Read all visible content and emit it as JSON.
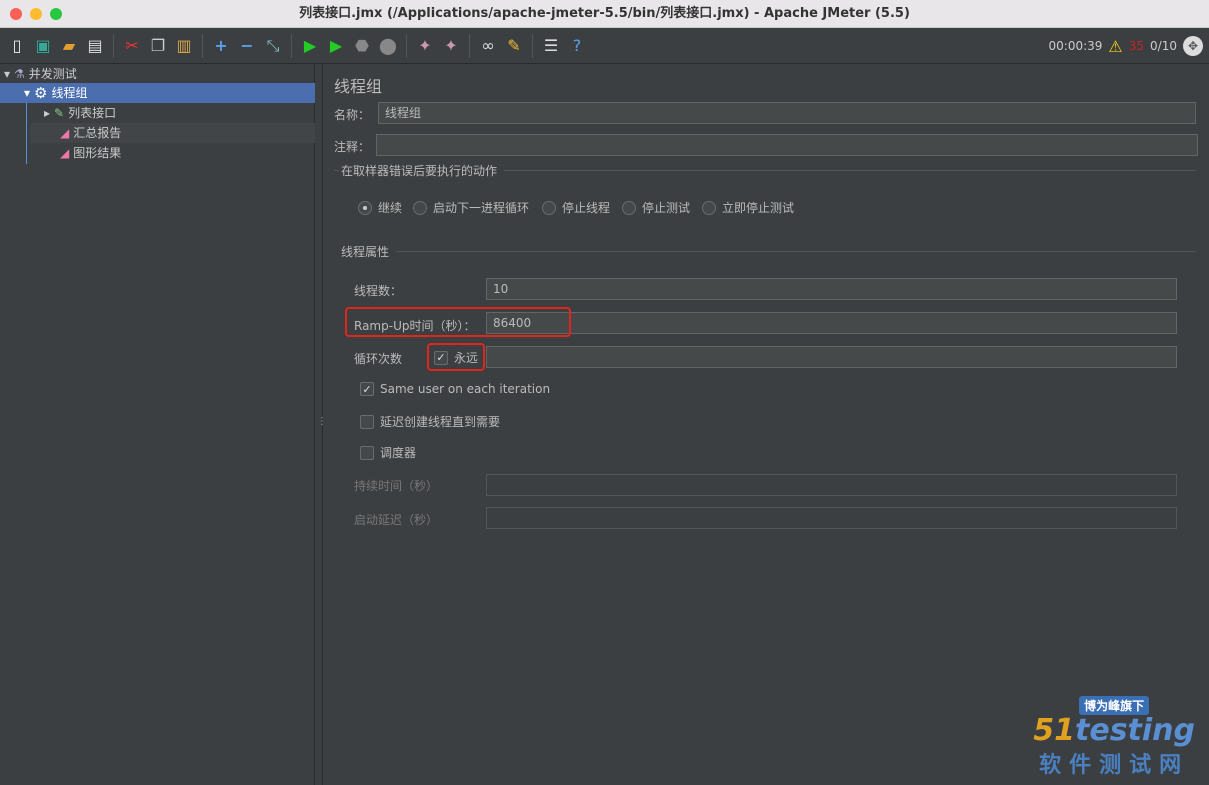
{
  "window": {
    "title": "列表接口.jmx (/Applications/apache-jmeter-5.5/bin/列表接口.jmx) - Apache JMeter (5.5)"
  },
  "toolbar": {
    "icons": [
      "new-icon",
      "templates-icon",
      "open-icon",
      "save-icon",
      "cut-icon",
      "copy-icon",
      "paste-icon",
      "expand-icon",
      "collapse-icon",
      "toggle-icon",
      "start-icon",
      "start-no-pause-icon",
      "stop-icon",
      "shutdown-icon",
      "clear-icon",
      "clear-all-icon",
      "search-icon",
      "reset-search-icon",
      "function-helper-icon",
      "help-icon"
    ],
    "elapsed": "00:00:39",
    "error_count": "35",
    "threads": "0/10"
  },
  "tree": {
    "items": [
      {
        "label": "并发测试"
      },
      {
        "label": "线程组"
      },
      {
        "label": "列表接口"
      },
      {
        "label": "汇总报告"
      },
      {
        "label": "图形结果"
      }
    ]
  },
  "panel": {
    "title": "线程组",
    "name_label": "名称：",
    "name_value": "线程组",
    "comment_label": "注释：",
    "comment_value": "",
    "error_group": "在取样器错误后要执行的动作",
    "error_options": [
      {
        "label": "继续",
        "selected": true
      },
      {
        "label": "启动下一进程循环",
        "selected": false
      },
      {
        "label": "停止线程",
        "selected": false
      },
      {
        "label": "停止测试",
        "selected": false
      },
      {
        "label": "立即停止测试",
        "selected": false
      }
    ],
    "thread_group": "线程属性",
    "threads_label": "线程数：",
    "threads_value": "10",
    "rampup_label": "Ramp-Up时间（秒）：",
    "rampup_value": "86400",
    "loop_label": "循环次数",
    "forever_label": "永远",
    "forever_checked": true,
    "loop_value": "",
    "same_user_label": "Same user on each iteration",
    "same_user_checked": true,
    "delay_label": "延迟创建线程直到需要",
    "delay_checked": false,
    "scheduler_label": "调度器",
    "scheduler_checked": false,
    "duration_label": "持续时间（秒）",
    "duration_value": "",
    "startup_label": "启动延迟（秒）",
    "startup_value": ""
  },
  "watermark": {
    "line1": "博为峰旗下",
    "line2": "51testing",
    "line3": "软件测试网"
  },
  "colors": {
    "selection": "#4b6eaf",
    "highlight": "#e0261c",
    "background": "#3c3f41"
  }
}
